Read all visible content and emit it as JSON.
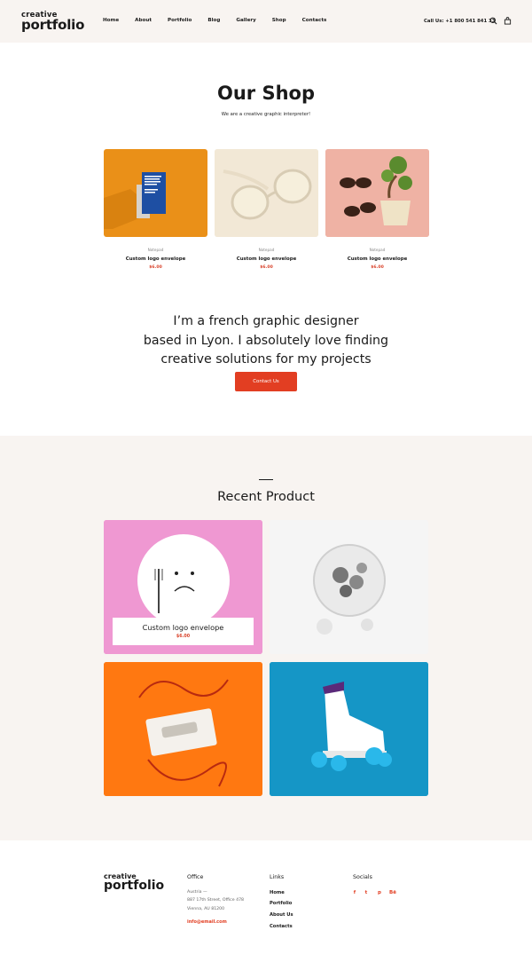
{
  "header": {
    "logo_top": "creative",
    "logo_bottom": "portfolio",
    "nav": [
      "Home",
      "About",
      "Portfolio",
      "Blog",
      "Gallery",
      "Shop",
      "Contacts"
    ],
    "call": "Call Us: +1 800 541 841 33",
    "icons": [
      "search-icon",
      "shopping-bag-icon"
    ]
  },
  "shop": {
    "title": "Our Shop",
    "subtitle": "We are a creative graphic interpreter!",
    "products": [
      {
        "vendor": "Notepad",
        "name": "Custom logo envelope",
        "price": "$6.00",
        "image": "blue book on orange background"
      },
      {
        "vendor": "Notepad",
        "name": "Custom logo envelope",
        "price": "$6.00",
        "image": "white sunglasses"
      },
      {
        "vendor": "Notepad",
        "name": "Custom logo envelope",
        "price": "$6.00",
        "image": "sunglasses on bonsai plant"
      }
    ]
  },
  "about": {
    "line1": "I’m a french graphic designer",
    "line2": "based in Lyon. I absolutely love finding",
    "line3": "creative solutions for my projects",
    "button": "Contact Us"
  },
  "recent": {
    "title": "Recent Product",
    "featured_name": "Custom logo envelope",
    "featured_price": "$6.00",
    "tiles": [
      "sad plate on pink",
      "glass orb with flowers",
      "cassette tape on orange",
      "roller skate on blue"
    ]
  },
  "footer": {
    "logo_top": "creative",
    "logo_bottom": "portfolio",
    "office_title": "Office",
    "address1": "Austria —",
    "address2": "887 17th Street, Office 478",
    "address3": "Vienna, AU 81200",
    "email": "info@email.com",
    "links_title": "Links",
    "links": [
      "Home",
      "Portfolio",
      "About Us",
      "Contacts"
    ],
    "socials_title": "Socials",
    "socials": [
      "f",
      "t",
      "p",
      "Bē"
    ]
  },
  "colors": {
    "accent": "#e23e22",
    "bg_soft": "#f8f4f1"
  }
}
